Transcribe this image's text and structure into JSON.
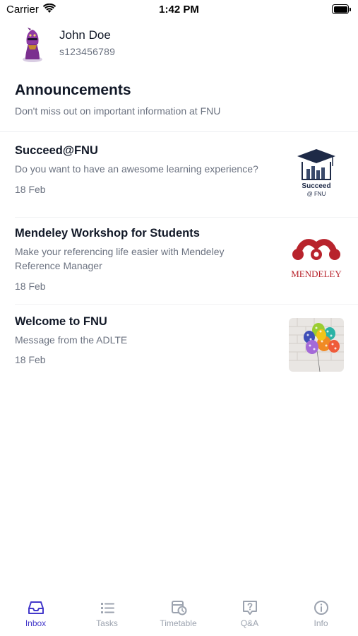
{
  "status_bar": {
    "carrier": "Carrier",
    "time": "1:42 PM"
  },
  "profile": {
    "name": "John Doe",
    "student_id": "s123456789"
  },
  "announcements": {
    "title": "Announcements",
    "subtitle": "Don't miss out on important information at FNU",
    "items": [
      {
        "title": "Succeed@FNU",
        "body": "Do you want to have an awesome learning experience?",
        "date": "18 Feb",
        "thumb_text_1": "Succeed",
        "thumb_text_2": "@ FNU"
      },
      {
        "title": "Mendeley Workshop for Students",
        "body": "Make your referencing life easier with Mendeley Reference Manager",
        "date": "18 Feb",
        "thumb_text_1": "MENDELEY"
      },
      {
        "title": "Welcome to FNU",
        "body": "Message from the ADLTE",
        "date": "18 Feb"
      }
    ]
  },
  "tabbar": {
    "active_color": "#4338ca",
    "inactive_color": "#9ca3af",
    "tabs": [
      {
        "label": "Inbox",
        "icon": "inbox-icon",
        "active": true
      },
      {
        "label": "Tasks",
        "icon": "list-icon",
        "active": false
      },
      {
        "label": "Timetable",
        "icon": "calendar-clock-icon",
        "active": false
      },
      {
        "label": "Q&A",
        "icon": "question-bubble-icon",
        "active": false
      },
      {
        "label": "Info",
        "icon": "info-icon",
        "active": false
      }
    ]
  }
}
